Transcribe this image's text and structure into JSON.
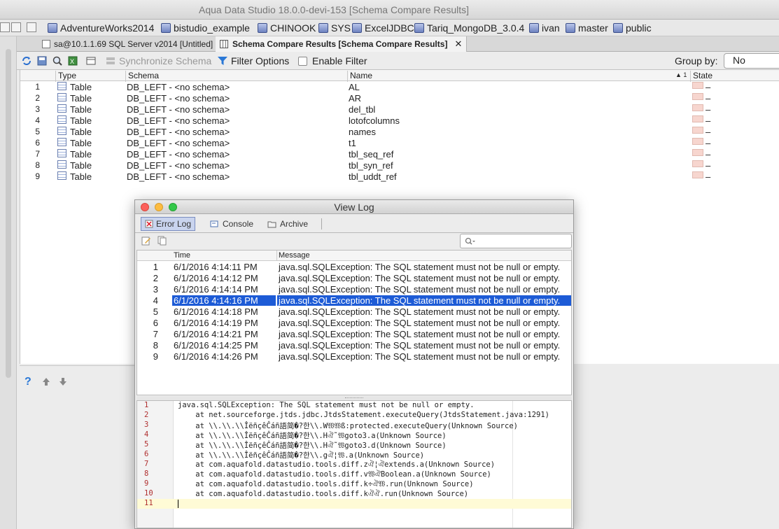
{
  "window": {
    "title": "Aqua Data Studio 18.0.0-devi-153 [Schema Compare Results]"
  },
  "connections": [
    "AdventureWorks2014",
    "bistudio_example",
    "CHINOOK",
    "SYS",
    "ExcelJDBC",
    "Tariq_MongoDB_3.0.4",
    "ivan",
    "master",
    "public"
  ],
  "tabs": [
    {
      "label": "sa@10.1.1.69 SQL Server v2014 [Untitled]",
      "close": "✕"
    },
    {
      "label": "Schema Compare Results [Schema Compare Results]",
      "close": "✕"
    }
  ],
  "toolbar": {
    "sync_label": "Synchronize Schema",
    "filter_label": "Filter Options",
    "enable_filter_label": "Enable Filter",
    "group_by_label": "Group by:",
    "group_by_value": "No Groups",
    "enable_filter_checked": false
  },
  "grid": {
    "headers": {
      "type": "Type",
      "schema": "Schema",
      "name": "Name",
      "sort_marker": "▲ 1",
      "state": "State"
    },
    "rows": [
      {
        "num": "1",
        "type": "Table",
        "schema": "DB_LEFT - <no schema>",
        "name": "AL",
        "state": "–"
      },
      {
        "num": "2",
        "type": "Table",
        "schema": "DB_LEFT - <no schema>",
        "name": "AR",
        "state": "–"
      },
      {
        "num": "3",
        "type": "Table",
        "schema": "DB_LEFT - <no schema>",
        "name": "del_tbl",
        "state": "–"
      },
      {
        "num": "4",
        "type": "Table",
        "schema": "DB_LEFT - <no schema>",
        "name": "lotofcolumns",
        "state": "–"
      },
      {
        "num": "5",
        "type": "Table",
        "schema": "DB_LEFT - <no schema>",
        "name": "names",
        "state": "–"
      },
      {
        "num": "6",
        "type": "Table",
        "schema": "DB_LEFT - <no schema>",
        "name": "t1",
        "state": "–"
      },
      {
        "num": "7",
        "type": "Table",
        "schema": "DB_LEFT - <no schema>",
        "name": "tbl_seq_ref",
        "state": "–"
      },
      {
        "num": "8",
        "type": "Table",
        "schema": "DB_LEFT - <no schema>",
        "name": "tbl_syn_ref",
        "state": "–"
      },
      {
        "num": "9",
        "type": "Table",
        "schema": "DB_LEFT - <no schema>",
        "name": "tbl_uddt_ref",
        "state": "–"
      }
    ]
  },
  "lower_panel": {
    "help": "?",
    "up": "🡅",
    "down": "🡇"
  },
  "view_log": {
    "title": "View Log",
    "tabs": [
      "Error Log",
      "Console",
      "Archive"
    ],
    "search_placeholder": "",
    "headers": {
      "time": "Time",
      "message": "Message"
    },
    "selected_row": 4,
    "rows": [
      {
        "num": "1",
        "time": "6/1/2016 4:14:11 PM",
        "message": "java.sql.SQLException: The SQL statement must not be null or empty."
      },
      {
        "num": "2",
        "time": "6/1/2016 4:14:12 PM",
        "message": "java.sql.SQLException: The SQL statement must not be null or empty."
      },
      {
        "num": "3",
        "time": "6/1/2016 4:14:14 PM",
        "message": "java.sql.SQLException: The SQL statement must not be null or empty."
      },
      {
        "num": "4",
        "time": "6/1/2016 4:14:16 PM",
        "message": "java.sql.SQLException: The SQL statement must not be null or empty."
      },
      {
        "num": "5",
        "time": "6/1/2016 4:14:18 PM",
        "message": "java.sql.SQLException: The SQL statement must not be null or empty."
      },
      {
        "num": "6",
        "time": "6/1/2016 4:14:19 PM",
        "message": "java.sql.SQLException: The SQL statement must not be null or empty."
      },
      {
        "num": "7",
        "time": "6/1/2016 4:14:21 PM",
        "message": "java.sql.SQLException: The SQL statement must not be null or empty."
      },
      {
        "num": "8",
        "time": "6/1/2016 4:14:25 PM",
        "message": "java.sql.SQLException: The SQL statement must not be null or empty."
      },
      {
        "num": "9",
        "time": "6/1/2016 4:14:26 PM",
        "message": "java.sql.SQLException: The SQL statement must not be null or empty."
      }
    ],
    "stack_trace": [
      {
        "n": "1",
        "text": "java.sql.SQLException: The SQL statement must not be null or empty."
      },
      {
        "n": "2",
        "text": "    at net.sourceforge.jtds.jdbc.JtdsStatement.executeQuery(JtdsStatement.java:1291)"
      },
      {
        "n": "3",
        "text": "    at \\\\.\\\\.\\\\ÎëñçêĈáñ語简�?한\\\\.W𝔚𝔚ß:protected.executeQuery(Unknown Source)"
      },
      {
        "n": "4",
        "text": "    at \\\\.\\\\.\\\\ÎëñçêĈáñ語简�?한\\\\.Hঐ˜𝔚goto3.a(Unknown Source)"
      },
      {
        "n": "5",
        "text": "    at \\\\.\\\\.\\\\ÎëñçêĈáñ語简�?한\\\\.Hঐ˜𝔚goto3.d(Unknown Source)"
      },
      {
        "n": "6",
        "text": "    at \\\\.\\\\.\\\\ÎëñçêĈáñ語简�?한\\\\.gঐ¦𝔚.a(Unknown Source)"
      },
      {
        "n": "7",
        "text": "    at com.aquafold.datastudio.tools.diff.zঐ¦ঐextends.a(Unknown Source)"
      },
      {
        "n": "8",
        "text": "    at com.aquafold.datastudio.tools.diff.v𝔚ঐBoolean.a(Unknown Source)"
      },
      {
        "n": "9",
        "text": "    at com.aquafold.datastudio.tools.diff.k÷ঐ𝔚.run(Unknown Source)"
      },
      {
        "n": "10",
        "text": "    at com.aquafold.datastudio.tools.diff.kঐঐ.run(Unknown Source)"
      },
      {
        "n": "11",
        "text": ""
      }
    ]
  },
  "colors": {
    "selection": "#1d5bd6",
    "state_missing": "#f7d6cf",
    "line_number": "#b03030",
    "current_line": "#fffbd6"
  }
}
